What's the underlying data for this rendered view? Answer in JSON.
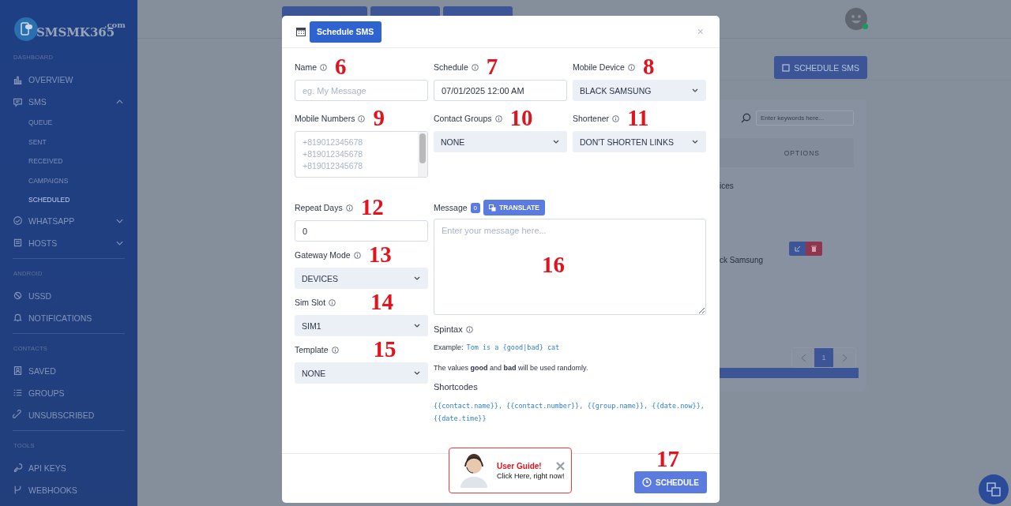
{
  "sidebar": {
    "logo": {
      "name": "SMSMK365",
      "suffix": ".com"
    },
    "sections": [
      {
        "title": "DASHBOARD",
        "items": [
          {
            "label": "OVERVIEW",
            "selected": false
          },
          {
            "label": "SMS",
            "selected": false,
            "expanded": true,
            "children": [
              {
                "label": "QUEUE",
                "selected": false
              },
              {
                "label": "SENT",
                "selected": false
              },
              {
                "label": "RECEIVED",
                "selected": false
              },
              {
                "label": "CAMPAIGNS",
                "selected": false
              },
              {
                "label": "SCHEDULED",
                "selected": true
              }
            ]
          },
          {
            "label": "WHATSAPP",
            "selected": false,
            "expanded": false
          },
          {
            "label": "HOSTS",
            "selected": false,
            "expanded": false
          }
        ]
      },
      {
        "title": "ANDROID",
        "items": [
          {
            "label": "USSD",
            "selected": false
          },
          {
            "label": "NOTIFICATIONS",
            "selected": false
          }
        ]
      },
      {
        "title": "CONTACTS",
        "items": [
          {
            "label": "SAVED",
            "selected": false
          },
          {
            "label": "GROUPS",
            "selected": false
          },
          {
            "label": "UNSUBSCRIBED",
            "selected": false
          }
        ]
      },
      {
        "title": "TOOLS",
        "items": [
          {
            "label": "API KEYS",
            "selected": false
          },
          {
            "label": "WEBHOOKS",
            "selected": false
          }
        ]
      }
    ]
  },
  "header": {
    "avatar_online": true
  },
  "page": {
    "schedule_button": "SCHEDULE SMS",
    "table": {
      "search_placeholder": "Enter keywords here...",
      "columns": [
        "OPTIONS"
      ],
      "rows": [
        {
          "cell": "ices",
          "actions": false
        },
        {
          "cell": "ck Samsung",
          "actions": true
        }
      ]
    },
    "pagination": [
      {
        "label": "1",
        "selected": true
      }
    ]
  },
  "modal": {
    "title": {
      "text": "Schedule SMS",
      "selected": true
    },
    "close": "×",
    "top_fields": [
      {
        "kind": "text",
        "label": "Name",
        "placeholder": "eg. My Message",
        "annotation": "6"
      },
      {
        "kind": "text",
        "label": "Schedule",
        "value": "07/01/2025 12:00 AM",
        "annotation": "7"
      },
      {
        "kind": "select",
        "label": "Mobile Device",
        "value": "BLACK SAMSUNG",
        "annotation": "8"
      },
      {
        "kind": "textarea",
        "label": "Mobile Numbers",
        "placeholder_lines": [
          "+819012345678",
          "+819012345678",
          "+819012345678"
        ],
        "annotation": "9"
      },
      {
        "kind": "select",
        "label": "Contact Groups",
        "value": "NONE",
        "annotation": "10"
      },
      {
        "kind": "select",
        "label": "Shortener",
        "value": "DON'T SHORTEN LINKS",
        "annotation": "11"
      }
    ],
    "left_fields": [
      {
        "kind": "text",
        "label": "Repeat Days",
        "value": "0",
        "annotation": "12"
      },
      {
        "kind": "select",
        "label": "Gateway Mode",
        "value": "DEVICES",
        "annotation": "13"
      },
      {
        "kind": "select",
        "label": "Sim Slot",
        "value": "SIM1",
        "annotation": "14"
      },
      {
        "kind": "select",
        "label": "Template",
        "value": "NONE",
        "annotation": "15"
      }
    ],
    "message": {
      "label": "Message",
      "count": "0",
      "translate": "TRANSLATE",
      "placeholder": "Enter your message here...",
      "annotation": "16"
    },
    "spintax": {
      "title": "Spintax",
      "example_label": "Example:",
      "example_code": "Tom is a {good|bad} cat",
      "note": "The values **good** and **bad** will be used randomly."
    },
    "shortcodes": {
      "title": "Shortcodes",
      "codes": "{{contact.name}}, {{contact.number}}, {{group.name}}, {{date.now}}, {{date.time}}"
    },
    "guide": {
      "title": "User Guide!",
      "text": "Click Here, right now!"
    },
    "submit": {
      "label": "SCHEDULE",
      "annotation": "17"
    }
  }
}
